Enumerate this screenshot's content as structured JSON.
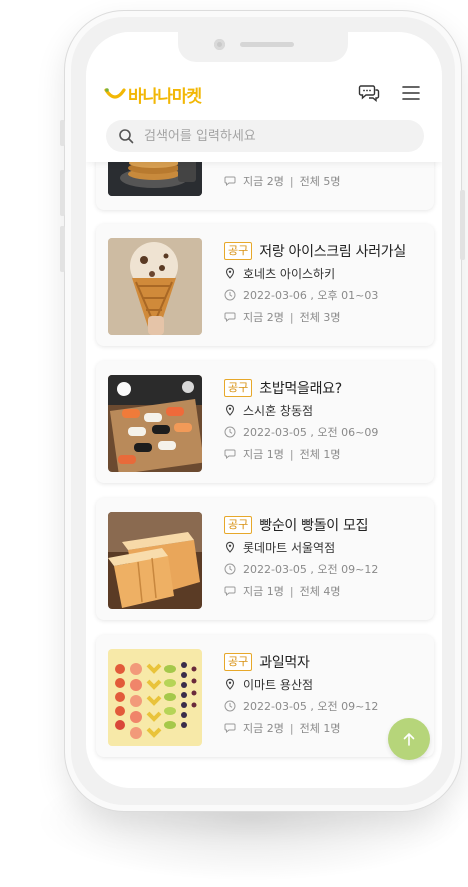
{
  "app": {
    "logo_text": "바나나마켓",
    "brand_color": "#f2b705",
    "accent_color": "#b6d57a"
  },
  "header": {
    "chat_icon": "chat-bubbles-icon",
    "menu_icon": "hamburger-menu-icon"
  },
  "search": {
    "placeholder": "검색어를 입력하세요",
    "icon": "search-icon"
  },
  "partial_item": {
    "now": "지금 2명",
    "total": "전체 5명"
  },
  "items": [
    {
      "badge": "공구",
      "title": "저랑 아이스크림 사러가실",
      "place": "호네츠 아이스하키",
      "datetime": "2022-03-06 , 오후 01~03",
      "now": "지금 2명",
      "total": "전체 3명",
      "image": "ice-cream-cone"
    },
    {
      "badge": "공구",
      "title": "초밥먹을래요?",
      "place": "스시혼 창동점",
      "datetime": "2022-03-05 , 오전 06~09",
      "now": "지금 1명",
      "total": "전체 1명",
      "image": "sushi-plate"
    },
    {
      "badge": "공구",
      "title": "빵순이 빵돌이 모집",
      "place": "롯데마트 서울역점",
      "datetime": "2022-03-05 , 오전 09~12",
      "now": "지금 1명",
      "total": "전체 4명",
      "image": "sliced-bread"
    },
    {
      "badge": "공구",
      "title": "과일먹자",
      "place": "이마트 용산점",
      "datetime": "2022-03-05 , 오전 09~12",
      "now": "지금 2명",
      "total": "전체 1명",
      "image": "fruit-rows"
    }
  ],
  "fab": {
    "icon": "arrow-up-icon"
  }
}
